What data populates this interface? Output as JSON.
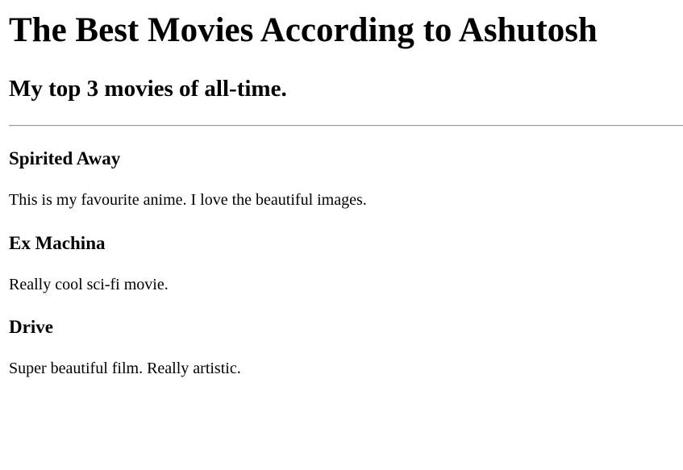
{
  "page": {
    "title": "The Best Movies According to Ashutosh",
    "subtitle": "My top 3 movies of all-time."
  },
  "movies": [
    {
      "title": "Spirited Away",
      "description": "This is my favourite anime. I love the beautiful images."
    },
    {
      "title": "Ex Machina",
      "description": "Really cool sci-fi movie."
    },
    {
      "title": "Drive",
      "description": "Super beautiful film. Really artistic."
    }
  ]
}
